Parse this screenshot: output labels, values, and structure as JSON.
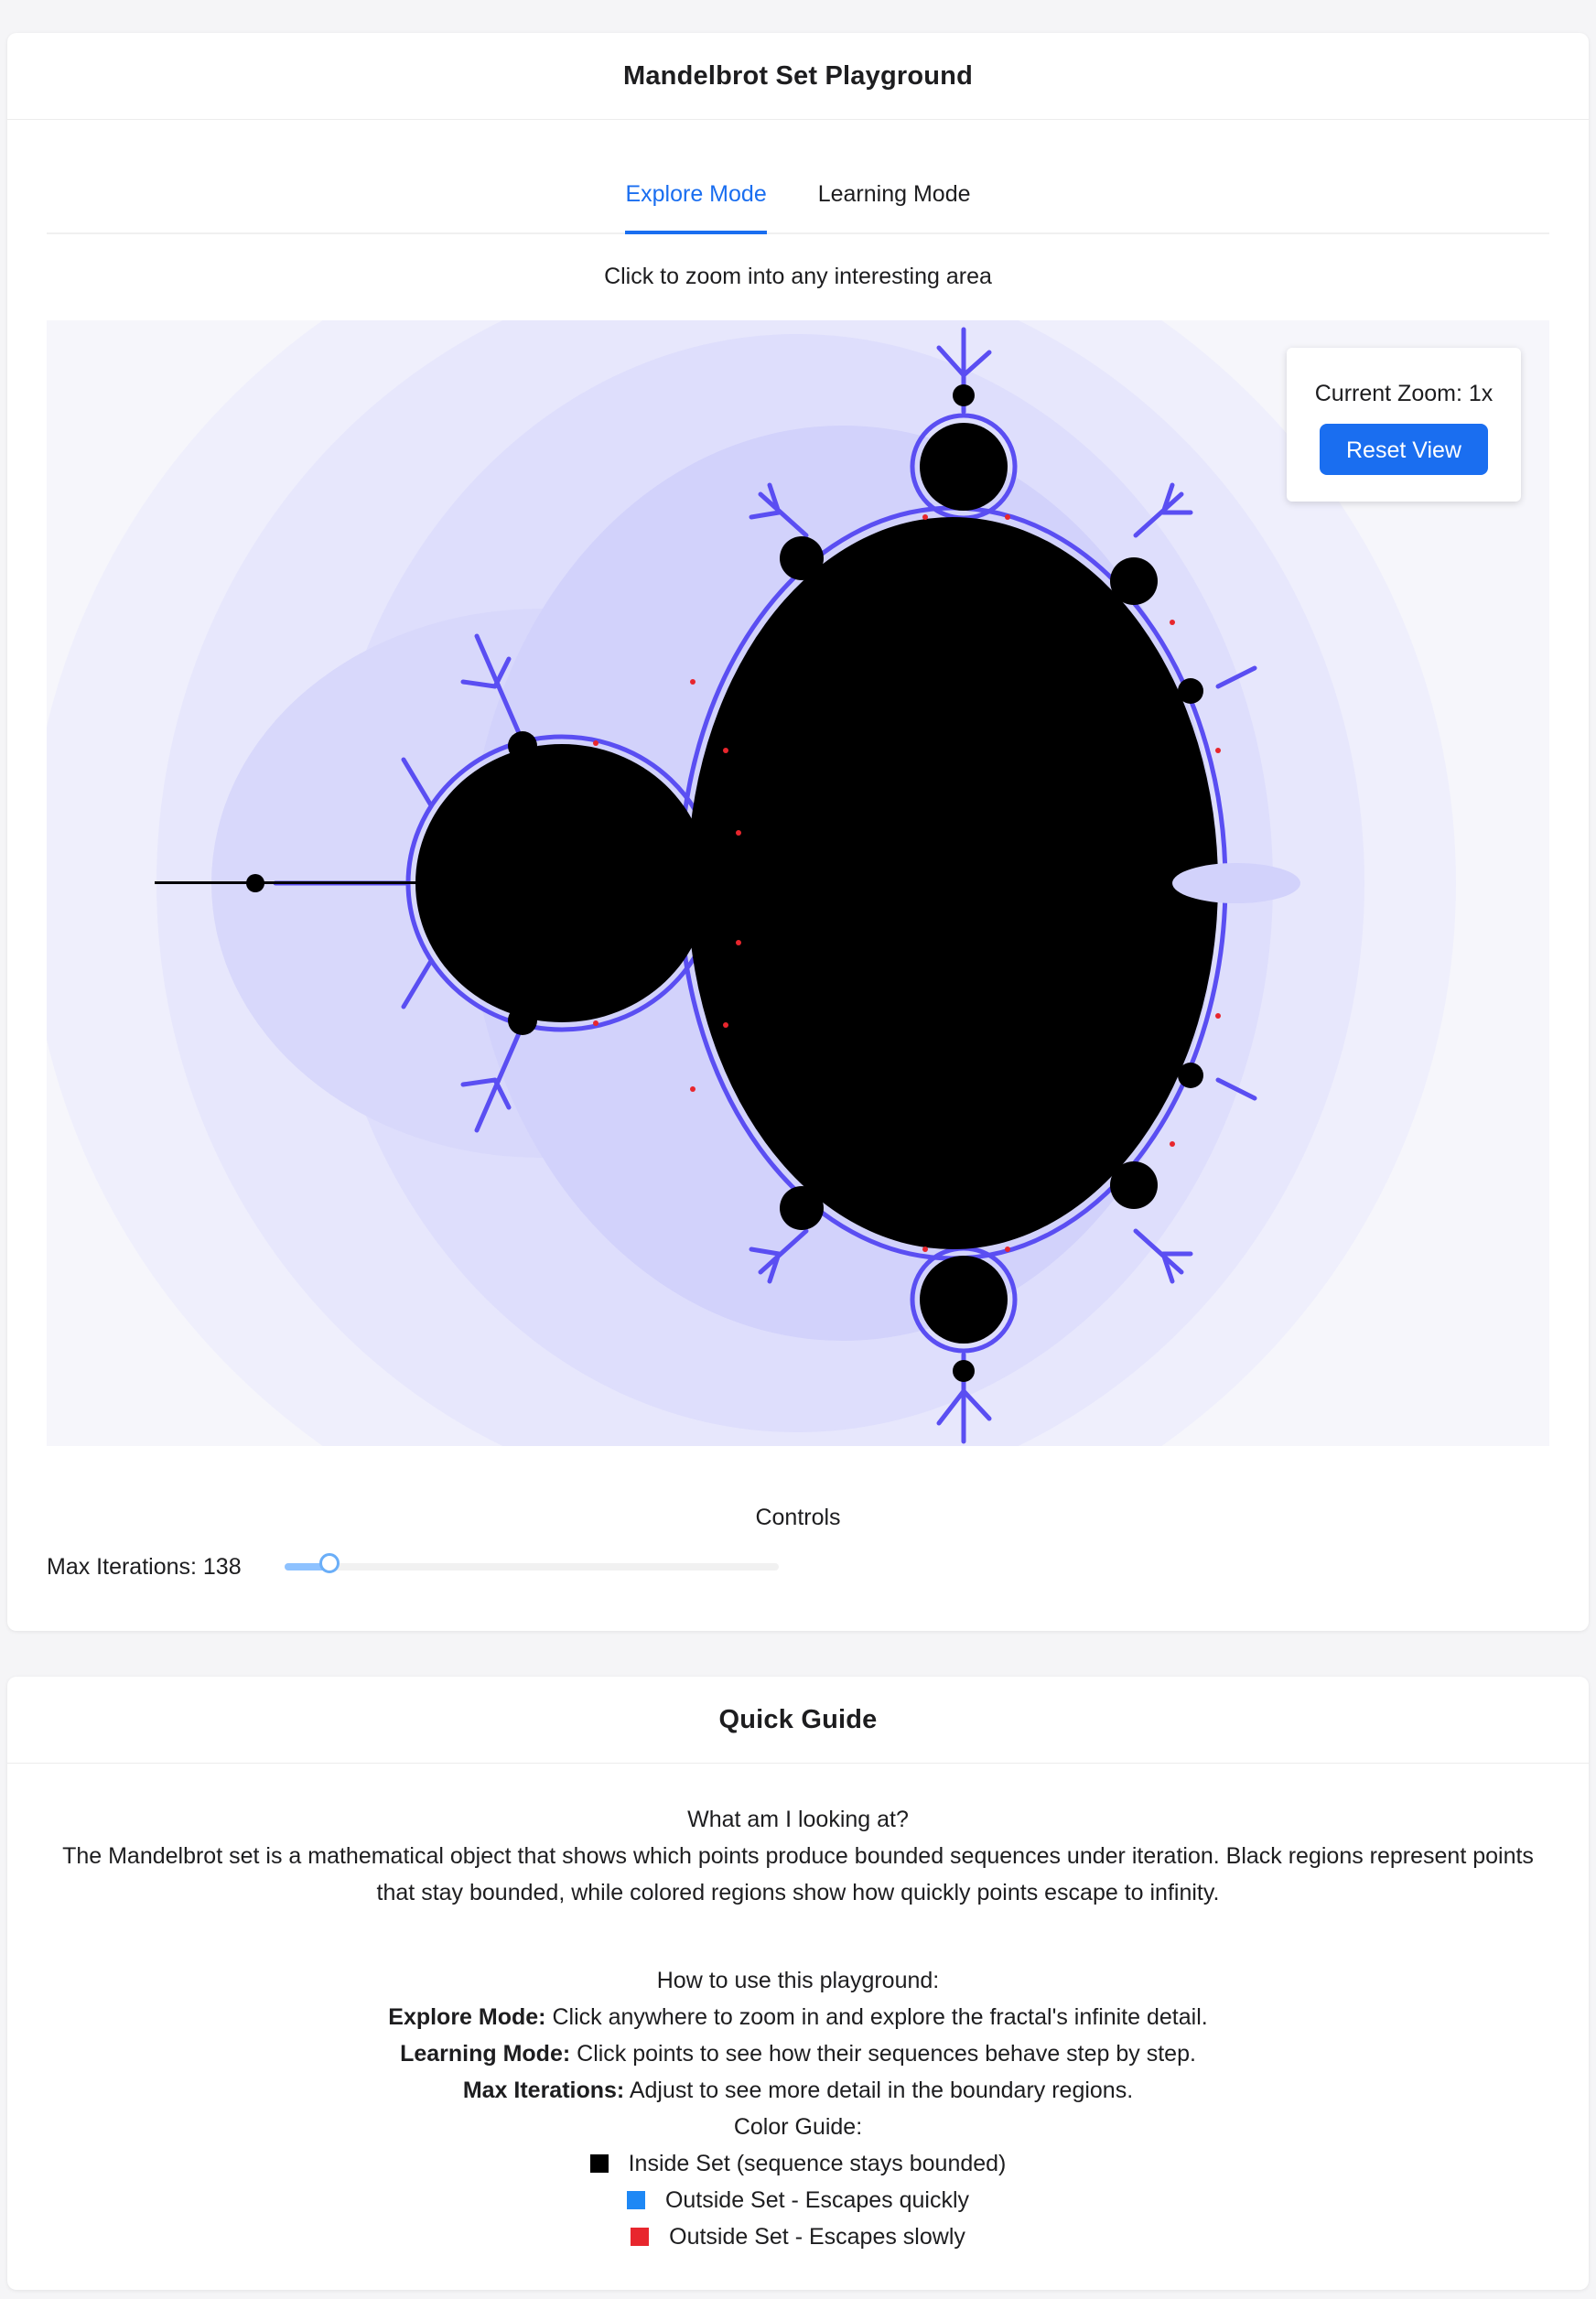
{
  "app": {
    "title": "Mandelbrot Set Playground"
  },
  "tabs": [
    {
      "label": "Explore Mode",
      "active": true
    },
    {
      "label": "Learning Mode",
      "active": false
    }
  ],
  "explore": {
    "instruction": "Click to zoom into any interesting area",
    "zoom_label": "Current Zoom: 1x",
    "reset_label": "Reset View"
  },
  "fractal": {
    "icon": "mandelbrot-set-render",
    "colors": {
      "inside": "#000000",
      "background": "#f6f6fb",
      "halo": "#dadafc",
      "boundary": "#4a3cf0",
      "slow_escape": "#e8262d"
    }
  },
  "controls": {
    "title": "Controls",
    "max_iterations_label": "Max Iterations: 138",
    "max_iterations_value": 138,
    "slider_fraction": 0.09
  },
  "guide": {
    "title": "Quick Guide",
    "question": "What am I looking at?",
    "paragraph": "The Mandelbrot set is a mathematical object that shows which points produce bounded sequences under iteration. Black regions represent points that stay bounded, while colored regions show how quickly points escape to infinity.",
    "how_title": "How to use this playground:",
    "explore_bold": "Explore Mode:",
    "explore_text": " Click anywhere to zoom in and explore the fractal's infinite detail.",
    "learning_bold": "Learning Mode:",
    "learning_text": " Click points to see how their sequences behave step by step.",
    "iter_bold": "Max Iterations:",
    "iter_text": " Adjust to see more detail in the boundary regions.",
    "color_title": "Color Guide:",
    "legend": [
      {
        "label": "Inside Set (sequence stays bounded)",
        "color": "#000000"
      },
      {
        "label": "Outside Set - Escapes quickly",
        "color": "#1e88f5"
      },
      {
        "label": "Outside Set - Escapes slowly",
        "color": "#e8262d"
      }
    ]
  }
}
